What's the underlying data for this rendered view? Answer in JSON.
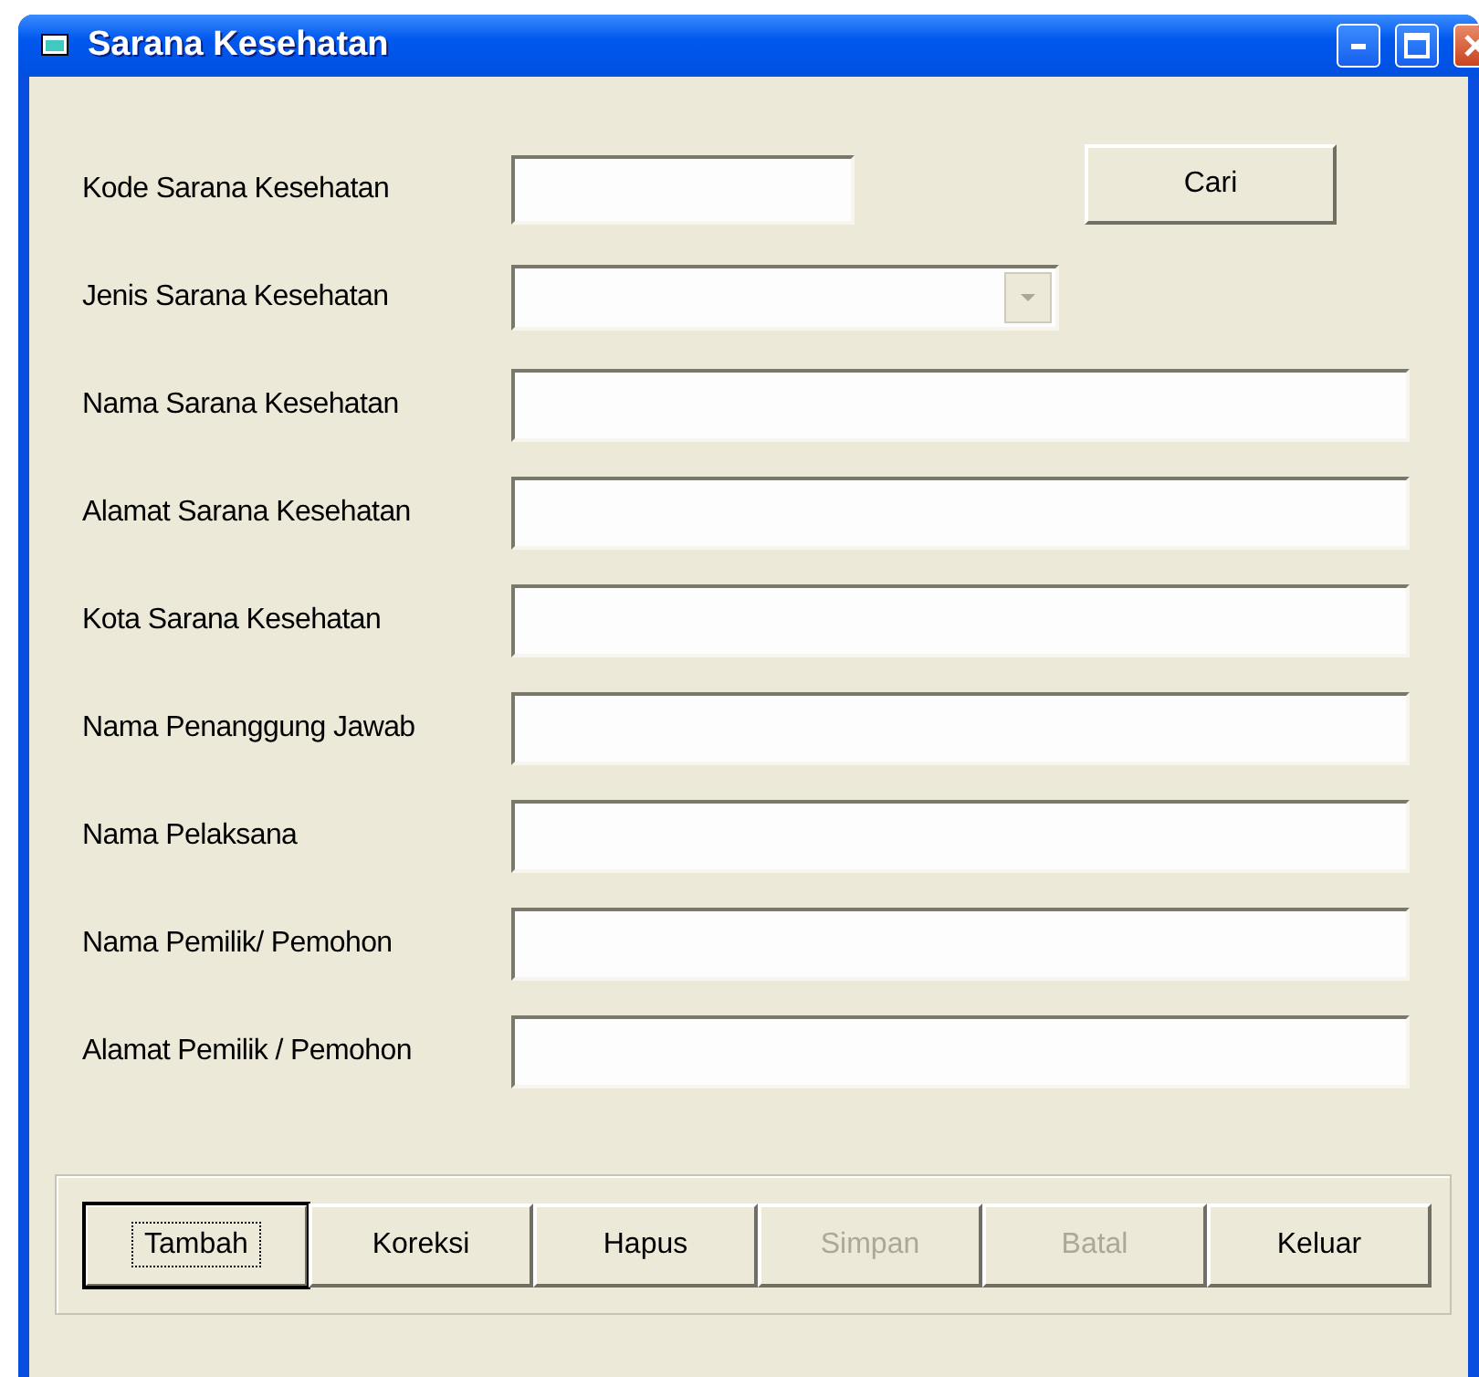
{
  "window": {
    "title": "Sarana Kesehatan"
  },
  "fields": [
    {
      "label": "Kode Sarana Kesehatan",
      "kind": "short"
    },
    {
      "label": "Jenis Sarana Kesehatan",
      "kind": "combo"
    },
    {
      "label": "Nama Sarana Kesehatan",
      "kind": "wide"
    },
    {
      "label": "Alamat Sarana Kesehatan",
      "kind": "wide"
    },
    {
      "label": "Kota Sarana Kesehatan",
      "kind": "wide"
    },
    {
      "label": "Nama Penanggung Jawab",
      "kind": "wide"
    },
    {
      "label": "Nama Pelaksana",
      "kind": "wide"
    },
    {
      "label": "Nama Pemilik/ Pemohon",
      "kind": "wide"
    },
    {
      "label": "Alamat Pemilik / Pemohon",
      "kind": "wide"
    }
  ],
  "search_button": "Cari",
  "buttons": [
    {
      "label": "Tambah",
      "disabled": false,
      "focused": true
    },
    {
      "label": "Koreksi",
      "disabled": false,
      "focused": false
    },
    {
      "label": "Hapus",
      "disabled": false,
      "focused": false
    },
    {
      "label": "Simpan",
      "disabled": true,
      "focused": false
    },
    {
      "label": "Batal",
      "disabled": true,
      "focused": false
    },
    {
      "label": "Keluar",
      "disabled": false,
      "focused": false
    }
  ]
}
